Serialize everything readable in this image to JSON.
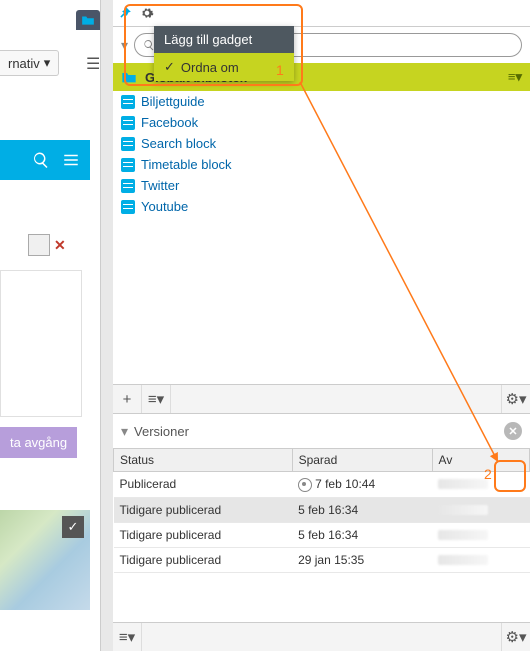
{
  "left": {
    "ternativ_label": "rnativ",
    "purple_btn": "ta avgång"
  },
  "menu": {
    "add_gadget": "Lägg till gadget",
    "rearrange": "Ordna om"
  },
  "library_header": "Globalt bibliotek",
  "blocks": [
    "Biljettguide",
    "Facebook",
    "Search block",
    "Timetable block",
    "Twitter",
    "Youtube"
  ],
  "versions": {
    "title": "Versioner",
    "columns": {
      "status": "Status",
      "saved": "Sparad",
      "by": "Av"
    },
    "rows": [
      {
        "status": "Publicerad",
        "published_icon": true,
        "saved": "7 feb 10:44",
        "selected": false
      },
      {
        "status": "Tidigare publicerad",
        "published_icon": false,
        "saved": "5 feb 16:34",
        "selected": true
      },
      {
        "status": "Tidigare publicerad",
        "published_icon": false,
        "saved": "5 feb 16:34",
        "selected": false
      },
      {
        "status": "Tidigare publicerad",
        "published_icon": false,
        "saved": "29 jan 15:35",
        "selected": false
      }
    ]
  },
  "annotations": {
    "num1": "1",
    "num2": "2"
  }
}
